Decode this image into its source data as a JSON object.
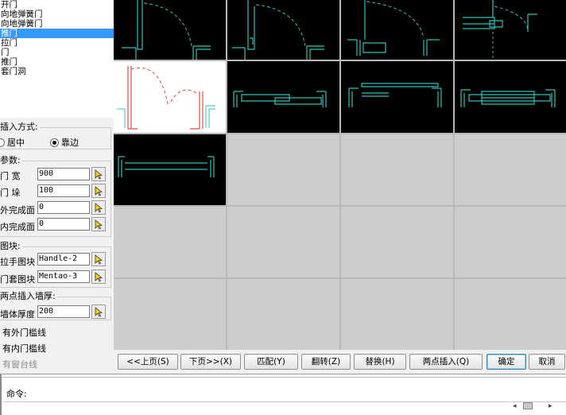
{
  "door_types": [
    {
      "label": "开门",
      "selected": false
    },
    {
      "label": "向地弹簧门",
      "selected": false
    },
    {
      "label": "向地弹簧门",
      "selected": false
    },
    {
      "label": "推门",
      "selected": true
    },
    {
      "label": "拉门",
      "selected": false
    },
    {
      "label": "门",
      "selected": false
    },
    {
      "label": "推门",
      "selected": false
    },
    {
      "label": "套门洞",
      "selected": false
    }
  ],
  "insert_mode": {
    "title": "插入方式:",
    "options": [
      {
        "label": "居中",
        "checked": false
      },
      {
        "label": "靠边",
        "checked": true
      }
    ]
  },
  "params": {
    "title": "参数:",
    "rows": [
      {
        "label": "门  宽",
        "value": "900"
      },
      {
        "label": "门  垛",
        "value": "100"
      },
      {
        "label": "外完成面",
        "value": "0"
      },
      {
        "label": "内完成面",
        "value": "0"
      }
    ]
  },
  "blocks": {
    "title": "图块:",
    "rows": [
      {
        "label": "拉手图块",
        "value": "Handle-2"
      },
      {
        "label": "门套图块",
        "value": "Mentao-3"
      }
    ]
  },
  "two_point": {
    "title": "两点插入墙厚:",
    "label": "墙体厚度",
    "value": "200"
  },
  "checkboxes": [
    {
      "label": "有外门槛线"
    },
    {
      "label": "有内门槛线"
    },
    {
      "label": "有窗台线"
    }
  ],
  "buttons": [
    {
      "label": "<<上页(S)"
    },
    {
      "label": "下页>>(X)"
    },
    {
      "label": "匹配(Y)"
    },
    {
      "label": "翻转(Z)"
    },
    {
      "label": "替换(H)"
    },
    {
      "label": "两点插入(Q)"
    },
    {
      "label": "确定"
    },
    {
      "label": "取消"
    }
  ],
  "command": {
    "label": "命令:"
  },
  "colors": {
    "selection": "#3399ff",
    "preview_background": "#000000",
    "empty_cell": "#cdcdcd",
    "wall_line": "#2ec4b6",
    "door_arc_red": "#e8484a",
    "selected_preview": "#ffffff"
  }
}
